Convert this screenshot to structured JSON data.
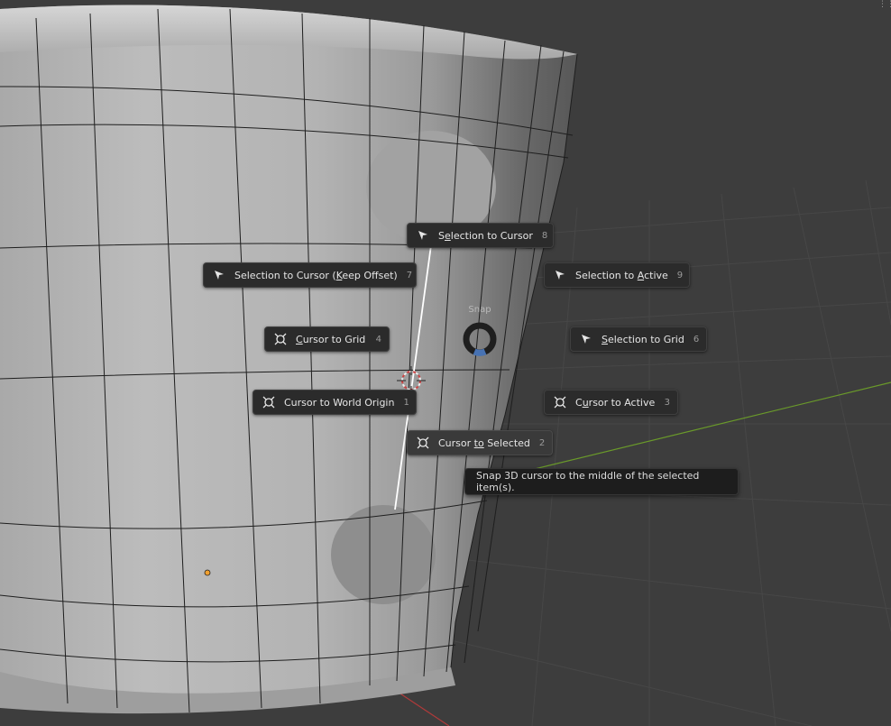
{
  "pie_menu": {
    "title": "Snap",
    "items": [
      {
        "id": "selection-to-cursor",
        "pre": "S",
        "u": "e",
        "post": "lection to Cursor",
        "key": "8",
        "icon": "cursor-arrow-icon"
      },
      {
        "id": "selection-to-cursor-keep-offset",
        "pre": "Selection to Cursor (",
        "u": "K",
        "post": "eep Offset)",
        "key": "7",
        "icon": "cursor-arrow-icon"
      },
      {
        "id": "selection-to-active",
        "pre": "Selection to ",
        "u": "A",
        "post": "ctive",
        "key": "9",
        "icon": "cursor-arrow-icon"
      },
      {
        "id": "cursor-to-grid",
        "pre": "",
        "u": "C",
        "post": "ursor to Grid",
        "key": "4",
        "icon": "cursor-3d-icon"
      },
      {
        "id": "selection-to-grid",
        "pre": "",
        "u": "S",
        "post": "election to Grid",
        "key": "6",
        "icon": "cursor-arrow-icon"
      },
      {
        "id": "cursor-to-world-origin",
        "pre": "Cursor to World Origin",
        "u": "",
        "post": "",
        "key": "1",
        "icon": "cursor-3d-icon"
      },
      {
        "id": "cursor-to-active",
        "pre": "C",
        "u": "u",
        "post": "rsor to Active",
        "key": "3",
        "icon": "cursor-3d-icon"
      },
      {
        "id": "cursor-to-selected",
        "pre": "Cursor ",
        "u": "to",
        "post": " Selected",
        "key": "2",
        "icon": "cursor-3d-icon"
      }
    ]
  },
  "tooltip": "Snap 3D cursor to the middle of the selected item(s).",
  "colors": {
    "background": "#3d3d3d",
    "menu_item": "#2b2b2b",
    "accent": "#4772b3",
    "x_axis": "#b03a3a",
    "y_axis": "#6a9a2a"
  }
}
